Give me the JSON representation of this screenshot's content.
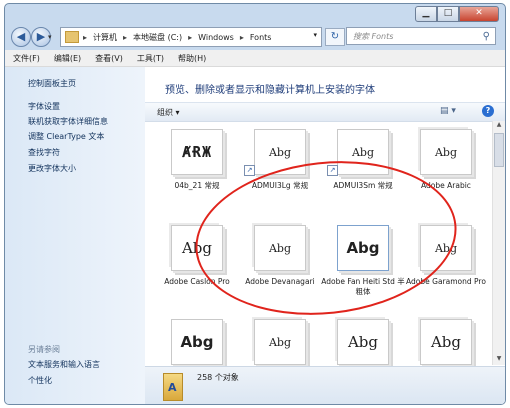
{
  "window": {
    "controls": {
      "minimize": "▁",
      "maximize": "□",
      "close": "✕"
    }
  },
  "nav": {
    "back_icon": "◀",
    "forward_icon": "▶",
    "breadcrumbs": [
      "计算机",
      "本地磁盘 (C:)",
      "Windows",
      "Fonts"
    ],
    "refresh_icon": "↻",
    "search_placeholder": "搜索 Fonts",
    "search_icon": "⚲"
  },
  "menu": [
    "文件(F)",
    "编辑(E)",
    "查看(V)",
    "工具(T)",
    "帮助(H)"
  ],
  "sidebar": {
    "home": "控制面板主页",
    "links": [
      "字体设置",
      "联机获取字体详细信息",
      "调整 ClearType 文本",
      "查找字符",
      "更改字体大小"
    ],
    "see_also_title": "另请参阅",
    "see_also": [
      "文本服务和输入语言",
      "个性化"
    ]
  },
  "main": {
    "heading": "预览、删除或者显示和隐藏计算机上安装的字体",
    "organize": "组织 ▾",
    "view_icon": "▤ ▾",
    "help": "?",
    "tiles": [
      {
        "preview": "ȺɌЖ",
        "label": "04b_21 常规"
      },
      {
        "preview": "Abg",
        "label": "ADMUI3Lg 常规"
      },
      {
        "preview": "Abg",
        "label": "ADMUI3Sm 常规"
      },
      {
        "preview": "Abg",
        "label": "Adobe Arabic"
      },
      {
        "preview": "Abg",
        "label": "Adobe Caslon Pro"
      },
      {
        "preview": "Abg",
        "label": "Adobe Devanagari"
      },
      {
        "preview": "Abg",
        "label": "Adobe Fan Heiti Std 半粗体"
      },
      {
        "preview": "Abg",
        "label": "Adobe Garamond Pro"
      },
      {
        "preview": "Abg",
        "label": ""
      },
      {
        "preview": "Abg",
        "label": ""
      },
      {
        "preview": "Abg",
        "label": ""
      },
      {
        "preview": "Abg",
        "label": ""
      }
    ],
    "status_count": "258 个对象"
  },
  "colors": {
    "annotation": "#e0241c",
    "heading": "#1f3d7a",
    "side_link": "#12325c"
  }
}
